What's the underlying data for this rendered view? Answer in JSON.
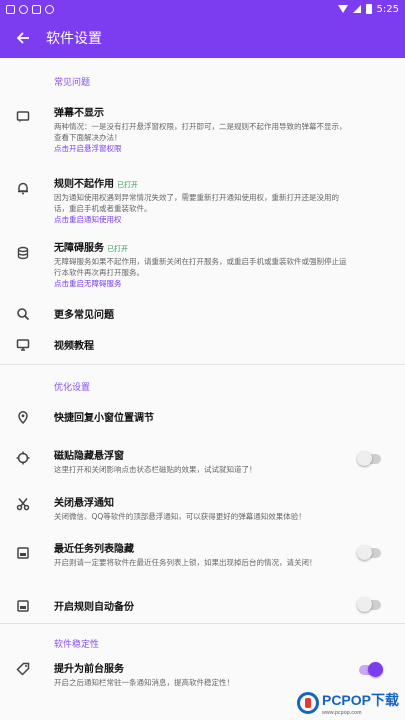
{
  "status": {
    "time": "5:25"
  },
  "appbar": {
    "back_icon": "back-arrow-icon",
    "title": "软件设置"
  },
  "sections": {
    "faq": "常见问题",
    "optimize": "优化设置",
    "stability": "软件稳定性"
  },
  "faq": {
    "not_shown": {
      "title": "弹幕不显示",
      "desc": "两种情况：一是没有打开悬浮窗权限，打开即可，二是规则不起作用导致的弹幕不显示，查看下面解决办法！",
      "link": "点击开启悬浮窗权限"
    },
    "rule_fail": {
      "title": "规则不起作用",
      "tag": "已打开",
      "desc": "因为通知使用权遇到异常情况失效了，需要重新打开通知使用权，重新打开还是没用的话，重启手机或者重装软件。",
      "link": "点击重启通知使用权"
    },
    "accessibility": {
      "title": "无障碍服务",
      "tag": "已打开",
      "desc": "无障碍服务如果不起作用，请重新关闭在打开服务，或重启手机或重装软件或强制停止运行本软件再次再打开服务。",
      "link": "点击重启无障碍服务"
    },
    "more": {
      "title": "更多常见问题"
    },
    "video": {
      "title": "视频教程"
    }
  },
  "optimize": {
    "quick_reply": {
      "title": "快捷回复小窗位置调节"
    },
    "snap_hide": {
      "title": "磁贴隐藏悬浮窗",
      "desc": "这里打开和关闭影响点击状态栏磁贴的效果，试试就知道了！",
      "enabled": false
    },
    "close_notify": {
      "title": "关闭悬浮通知",
      "desc": "关闭微信、QQ等软件的顶部悬浮通知，可以获得更好的弹幕通知效果体验！"
    },
    "hide_recent": {
      "title": "最近任务列表隐藏",
      "desc": "开启则请一定要将软件在最近任务列表上锁，如果出现掉后台的情况，请关闭！",
      "enabled": false
    },
    "auto_backup": {
      "title": "开启规则自动备份",
      "enabled": false
    }
  },
  "stability": {
    "foreground": {
      "title": "提升为前台服务",
      "desc": "开启之后通知栏常驻一条通知消息，提高软件稳定性！",
      "enabled": true
    }
  },
  "watermark": {
    "text": "PCPOP下载",
    "sub": "www.pcpop.com"
  }
}
